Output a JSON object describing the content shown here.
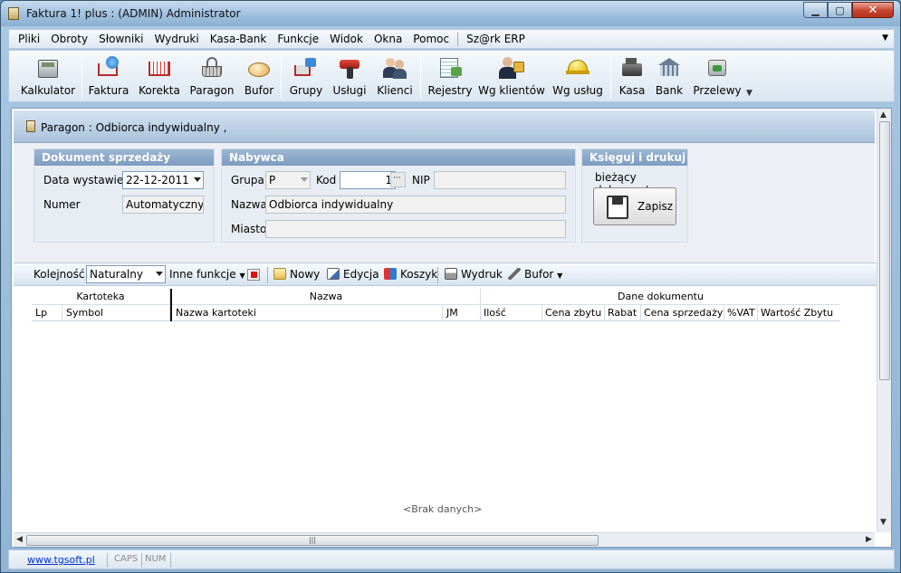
{
  "window": {
    "title": "Faktura 1! plus    : (ADMIN) Administrator"
  },
  "menu": {
    "items": [
      "Pliki",
      "Obroty",
      "Słowniki",
      "Wydruki",
      "Kasa-Bank",
      "Funkcje",
      "Widok",
      "Okna",
      "Pomoc"
    ],
    "extra": "Sz@rk ERP"
  },
  "toolbar": {
    "items": [
      "Kalkulator",
      "Faktura",
      "Korekta",
      "Paragon",
      "Bufor",
      "Grupy",
      "Usługi",
      "Klienci",
      "Rejestry",
      "Wg klientów",
      "Wg usług",
      "Kasa",
      "Bank",
      "Przelewy"
    ]
  },
  "document": {
    "caption": "Paragon : Odbiorca indywidualny ,",
    "sprzedaz": {
      "header": "Dokument sprzedaży",
      "date_label": "Data wystawienia",
      "date_value": "22-12-2011",
      "number_label": "Numer",
      "number_value": "Automatyczny"
    },
    "nabywca": {
      "header": "Nabywca",
      "grupa_label": "Grupa",
      "grupa_value": "P",
      "kod_label": "Kod",
      "kod_value": "1",
      "nip_label": "NIP",
      "nip_value": "",
      "nazwa_label": "Nazwa",
      "nazwa_value": "Odbiorca indywidualny",
      "miasto_label": "Miasto",
      "miasto_value": ""
    },
    "ksieguj": {
      "header": "Księguj i drukuj",
      "note": "bieżący dokument",
      "save_label": "Zapisz"
    }
  },
  "gridtoolbar": {
    "order_label": "Kolejność",
    "order_value": "Naturalny",
    "functions_label": "Inne funkcje",
    "new_label": "Nowy",
    "edit_label": "Edycja",
    "basket_label": "Koszyk",
    "print_label": "Wydruk",
    "buffer_label": "Bufor"
  },
  "grid": {
    "groups": [
      "Kartoteka",
      "Nazwa",
      "Dane dokumentu"
    ],
    "columns": [
      "Lp",
      "Symbol",
      "Nazwa kartoteki",
      "JM",
      "Ilość",
      "Cena zbytu",
      "Rabat",
      "Cena sprzedaży",
      "%VAT",
      "Wartość Zbytu"
    ],
    "empty_text": "<Brak danych>"
  },
  "statusbar": {
    "link": "www.tgsoft.pl",
    "caps": "CAPS",
    "num": "NUM"
  }
}
